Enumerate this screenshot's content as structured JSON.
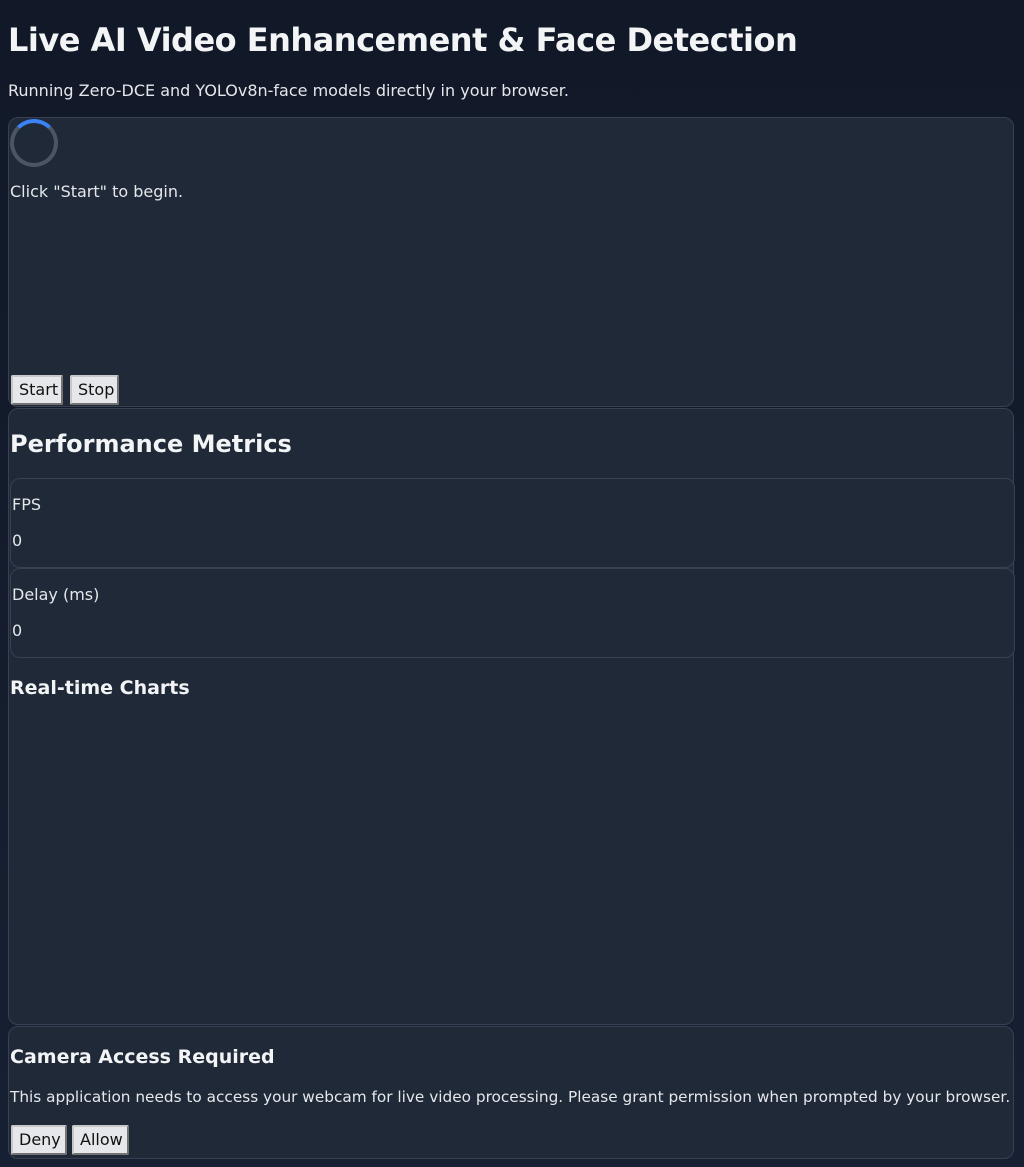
{
  "header": {
    "title": "Live AI Video Enhancement & Face Detection",
    "subtitle": "Running Zero-DCE and YOLOv8n-face models directly in your browser."
  },
  "video": {
    "status": "Click \"Start\" to begin.",
    "start_label": "Start",
    "stop_label": "Stop"
  },
  "metrics": {
    "heading": "Performance Metrics",
    "fps_label": "FPS",
    "fps_value": "0",
    "delay_label": "Delay (ms)",
    "delay_value": "0",
    "charts_heading": "Real-time Charts"
  },
  "camera_prompt": {
    "heading": "Camera Access Required",
    "text": "This application needs to access your webcam for live video processing. Please grant permission when prompted by your browser.",
    "deny_label": "Deny",
    "allow_label": "Allow"
  },
  "colors": {
    "background": "#111827",
    "panel": "#1f2937",
    "border": "#374151",
    "spinner_accent": "#3b82f6"
  }
}
